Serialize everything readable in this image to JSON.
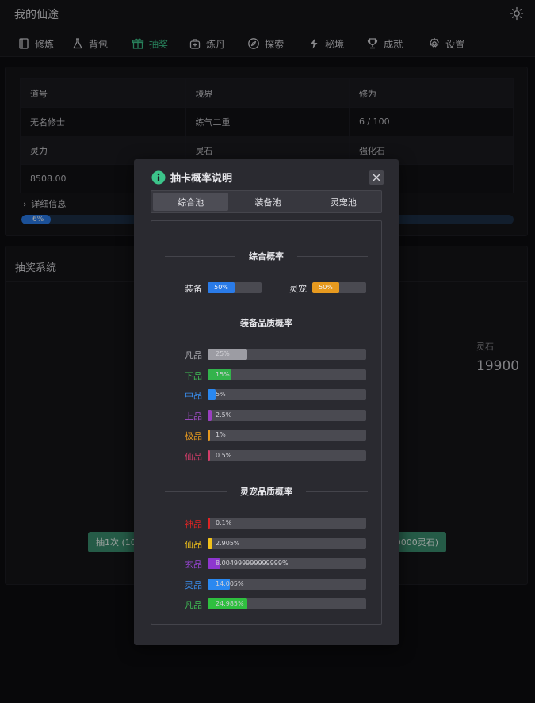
{
  "app": {
    "title": "我的仙途"
  },
  "nav": [
    {
      "label": "修炼",
      "icon": "book-icon"
    },
    {
      "label": "背包",
      "icon": "flask-icon"
    },
    {
      "label": "抽奖",
      "icon": "gift-icon",
      "active": true
    },
    {
      "label": "炼丹",
      "icon": "pot-icon"
    },
    {
      "label": "探索",
      "icon": "compass-icon"
    },
    {
      "label": "秘境",
      "icon": "lightning-icon"
    },
    {
      "label": "成就",
      "icon": "trophy-icon"
    },
    {
      "label": "设置",
      "icon": "gear-icon"
    }
  ],
  "stats": {
    "headers1": [
      "道号",
      "境界",
      "修为"
    ],
    "values1": [
      "无名修士",
      "练气二重",
      "6 / 100"
    ],
    "headers2": [
      "灵力",
      "灵石",
      "强化石"
    ],
    "values2": [
      "8508.00",
      "",
      ""
    ],
    "detail_label": "详细信息",
    "progress": {
      "value": 6,
      "label": "6%"
    }
  },
  "gacha": {
    "title": "抽奖系统",
    "stone_label": "灵石",
    "stone_value": "19900",
    "draw_one_label": "抽1次 (100",
    "draw_ten_label": "0000灵石)"
  },
  "modal": {
    "title": "抽卡概率说明",
    "tabs": [
      "综合池",
      "装备池",
      "灵宠池"
    ],
    "active_tab": 0,
    "overall": {
      "title": "综合概率",
      "items": [
        {
          "label": "装备",
          "value": 50,
          "text": "50%",
          "color": "#2a7be8"
        },
        {
          "label": "灵宠",
          "value": 50,
          "text": "50%",
          "color": "#e79a1f"
        }
      ]
    },
    "equipment": {
      "title": "装备品质概率",
      "items": [
        {
          "label": "凡品",
          "value": 25,
          "text": "25%",
          "color": "#9c9ca3",
          "label_color": "#a8a8ae"
        },
        {
          "label": "下品",
          "value": 15,
          "text": "15%",
          "color": "#33b34c",
          "label_color": "#3fbf55"
        },
        {
          "label": "中品",
          "value": 5,
          "text": "5%",
          "color": "#2a88f0",
          "label_color": "#3a8ff0"
        },
        {
          "label": "上品",
          "value": 2.5,
          "text": "2.5%",
          "color": "#9a3fc0",
          "label_color": "#a64fcc"
        },
        {
          "label": "极品",
          "value": 1,
          "text": "1%",
          "color": "#e79a1f",
          "label_color": "#e79a1f"
        },
        {
          "label": "仙品",
          "value": 0.5,
          "text": "0.5%",
          "color": "#d43d6a",
          "label_color": "#d43d6a"
        }
      ]
    },
    "pet": {
      "title": "灵宠品质概率",
      "items": [
        {
          "label": "神品",
          "value": 0.1,
          "text": "0.1%",
          "color": "#e02424",
          "label_color": "#e02424"
        },
        {
          "label": "仙品",
          "value": 2.905,
          "text": "2.905%",
          "color": "#f2c21a",
          "label_color": "#f2c21a"
        },
        {
          "label": "玄品",
          "value": 8.004999999999999,
          "text": "8.004999999999999%",
          "color": "#8e36cf",
          "label_color": "#9a45d6"
        },
        {
          "label": "灵品",
          "value": 14.005,
          "text": "14.005%",
          "color": "#2a88f0",
          "label_color": "#3a8ff0"
        },
        {
          "label": "凡品",
          "value": 24.985,
          "text": "24.985%",
          "color": "#2fbf3f",
          "label_color": "#3fbf55"
        }
      ]
    }
  }
}
